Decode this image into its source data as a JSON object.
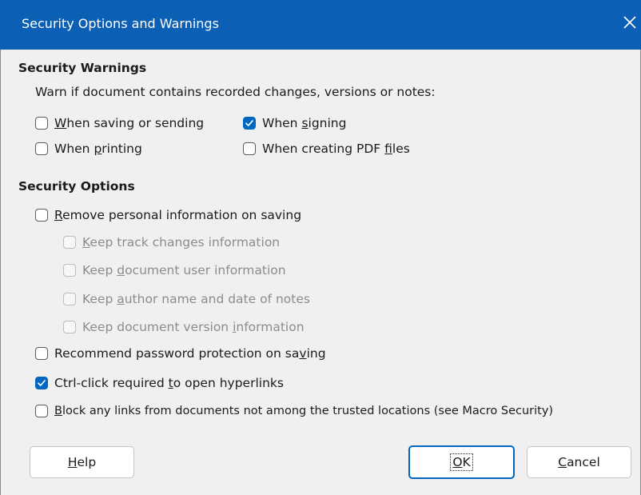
{
  "dialog": {
    "title": "Security Options and Warnings",
    "close_icon": "close-icon"
  },
  "warnings": {
    "heading": "Security Warnings",
    "intro": "Warn if document contains recorded changes, versions or notes:",
    "options": [
      {
        "pre": "",
        "u": "W",
        "post": "hen saving or sending",
        "checked": false
      },
      {
        "pre": "When ",
        "u": "s",
        "post": "igning",
        "checked": true
      },
      {
        "pre": "When ",
        "u": "p",
        "post": "rinting",
        "checked": false
      },
      {
        "pre": "When creating PDF ",
        "u": "f",
        "post": "iles",
        "checked": false
      }
    ]
  },
  "security_options": {
    "heading": "Security Options",
    "remove_personal": {
      "pre": "",
      "u": "R",
      "post": "emove personal information on saving",
      "checked": false
    },
    "sub_options": [
      {
        "pre": "",
        "u": "K",
        "post": "eep track changes information",
        "checked": false,
        "enabled": false
      },
      {
        "pre": "Keep ",
        "u": "d",
        "post": "ocument user information",
        "checked": false,
        "enabled": false
      },
      {
        "pre": "Keep ",
        "u": "a",
        "post": "uthor name and date of notes",
        "checked": false,
        "enabled": false
      },
      {
        "pre": "Keep document version ",
        "u": "i",
        "post": "nformation",
        "checked": false,
        "enabled": false
      }
    ],
    "recommend_password": {
      "pre": "Recommend password protection on sa",
      "u": "v",
      "post": "ing",
      "checked": false
    },
    "ctrl_click": {
      "pre": "Ctrl-click required ",
      "u": "t",
      "post": "o open hyperlinks",
      "checked": true
    },
    "block_links": {
      "pre": "",
      "u": "B",
      "post": "lock any links from documents not among the trusted locations (see Macro Security)",
      "checked": false
    }
  },
  "buttons": {
    "help": {
      "pre": "",
      "u": "H",
      "post": "elp"
    },
    "ok": {
      "pre": "",
      "u": "O",
      "post": "K"
    },
    "cancel": {
      "pre": "",
      "u": "C",
      "post": "ancel"
    }
  },
  "colors": {
    "titlebar": "#0b5fb4",
    "accent": "#0067c0",
    "background": "#f0f0f0"
  }
}
